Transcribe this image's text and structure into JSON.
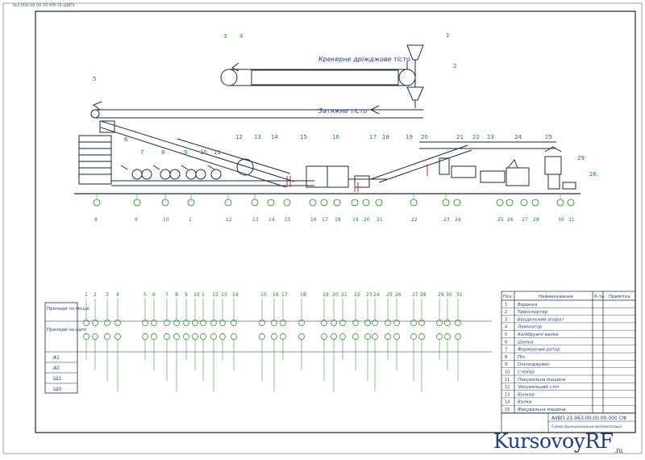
{
  "stamp": "№3 000 00 00 00 КМ-ТЕ-ЦВЕЧ",
  "flow_labels": {
    "cracker": "Крекерне дріжджове тісто",
    "drag": "Затяжне тісто"
  },
  "numbers_top": [
    "1",
    "2",
    "3",
    "4",
    "5",
    "6",
    "7",
    "8",
    "9",
    "10",
    "11",
    "12",
    "13",
    "14",
    "15",
    "16",
    "17",
    "18",
    "19",
    "20",
    "21",
    "22",
    "23",
    "24",
    "25",
    "26",
    "29"
  ],
  "motor_numbers": [
    "8",
    "9",
    "10",
    "1",
    "12",
    "13",
    "14",
    "15",
    "16",
    "17",
    "18",
    "19",
    "20",
    "21",
    "22",
    "23",
    "24",
    "25",
    "26",
    "27",
    "28",
    "30",
    "31"
  ],
  "legend_rows": [
    "Прилади по місцю",
    "Прилади на щиті",
    "А1",
    "А0",
    "Ш1",
    "Ш0"
  ],
  "scheme_numbers": [
    "1",
    "2",
    "3",
    "4",
    "5",
    "6",
    "7",
    "8",
    "9",
    "10",
    "1",
    "12",
    "13",
    "14",
    "15",
    "16",
    "17",
    "18",
    "19",
    "20",
    "21",
    "22",
    "23",
    "24",
    "25",
    "26",
    "27",
    "28",
    "29",
    "30",
    "31"
  ],
  "table": {
    "headers": [
      "Поз.",
      "Найменування",
      "К-ть",
      "Примітка"
    ],
    "rows": [
      [
        "1",
        "Воронка",
        ""
      ],
      [
        "2",
        "Транспортер",
        ""
      ],
      [
        "3",
        "Бродильний апарат",
        ""
      ],
      [
        "4",
        "Ламінатор",
        ""
      ],
      [
        "5",
        "Калібруючі валки",
        ""
      ],
      [
        "6",
        "Шнека",
        ""
      ],
      [
        "7",
        "Формуючий ротор",
        ""
      ],
      [
        "8",
        "Піч",
        ""
      ],
      [
        "9",
        "Охолоджувач",
        ""
      ],
      [
        "10",
        "Стекер",
        ""
      ],
      [
        "11",
        "Пакувальна машина",
        ""
      ],
      [
        "12",
        "Чекувальний стіл",
        ""
      ],
      [
        "13",
        "Бункер",
        ""
      ],
      [
        "14",
        "Валки",
        ""
      ],
      [
        "15",
        "Фасувальна машина",
        ""
      ]
    ]
  },
  "title_block": {
    "code": "АУВП-21-063.00.00.00.000 СФ",
    "name": "Схема функціональна автоматизації"
  },
  "watermark": {
    "main": "KursovoyRF",
    "sub": ".ru"
  },
  "colors": {
    "line": "#1e2a3a",
    "accent": "#1a8a1a",
    "flow": "#1d3b8f"
  }
}
